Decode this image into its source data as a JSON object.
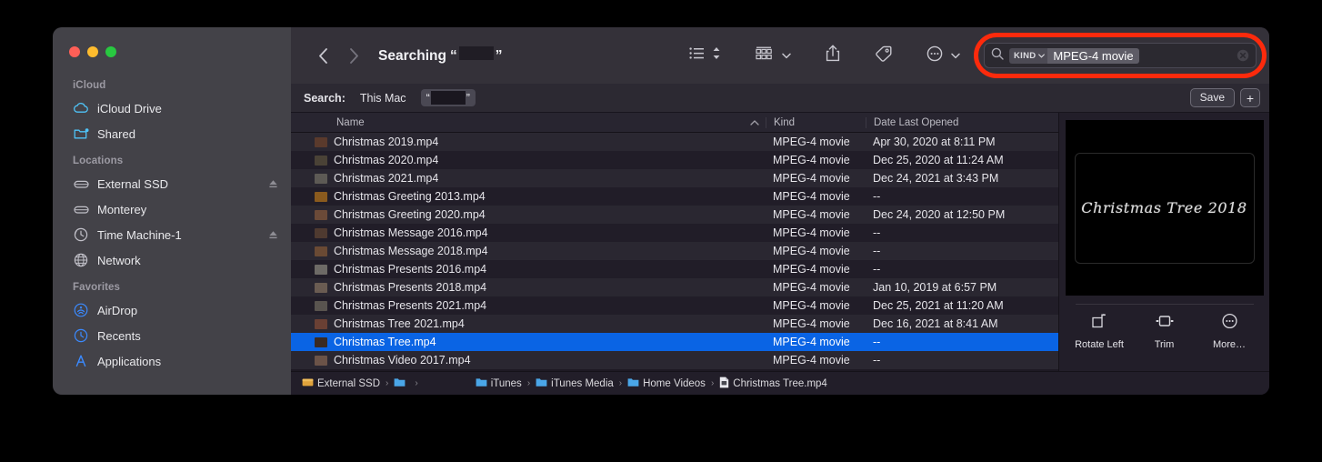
{
  "window": {
    "traffic_lights": [
      "close",
      "minimize",
      "zoom"
    ],
    "title_prefix": "Searching",
    "title_quote_open": "“",
    "title_quote_close": "”"
  },
  "sidebar": {
    "sections": [
      {
        "title": "iCloud",
        "items": [
          {
            "label": "iCloud Drive",
            "icon": "cloud-icon",
            "eject": false
          },
          {
            "label": "Shared",
            "icon": "shared-folder-icon",
            "eject": false
          }
        ]
      },
      {
        "title": "Locations",
        "items": [
          {
            "label": "External SSD",
            "icon": "external-drive-icon",
            "eject": true
          },
          {
            "label": "Monterey",
            "icon": "internal-drive-icon",
            "eject": false
          },
          {
            "label": "Time Machine-1",
            "icon": "time-machine-icon",
            "eject": true
          },
          {
            "label": "Network",
            "icon": "globe-icon",
            "eject": false
          }
        ]
      },
      {
        "title": "Favorites",
        "items": [
          {
            "label": "AirDrop",
            "icon": "airdrop-icon",
            "eject": false
          },
          {
            "label": "Recents",
            "icon": "clock-icon",
            "eject": false
          },
          {
            "label": "Applications",
            "icon": "applications-icon",
            "eject": false
          }
        ]
      }
    ]
  },
  "toolbar": {
    "back_icon": "chevron-left-icon",
    "forward_icon": "chevron-right-icon",
    "view_list_icon": "list-view-icon",
    "view_sort_icon": "sort-chevrons-icon",
    "group_icon": "group-by-icon",
    "group_chevron_icon": "chevron-down-icon",
    "share_icon": "share-icon",
    "tag_icon": "tag-icon",
    "more_icon": "more-circle-icon",
    "more_chevron_icon": "chevron-down-icon"
  },
  "search": {
    "icon": "search-icon",
    "token_kind_label": "KIND",
    "token_kind_chevron": "⌄",
    "token_value": "MPEG-4 movie",
    "clear_icon": "clear-circle-icon",
    "highlight_color": "#fc2a0c"
  },
  "scope_bar": {
    "label": "Search:",
    "tabs": [
      "This Mac"
    ],
    "selected_tab_quote_open": "“",
    "selected_tab_quote_close": "”",
    "save_label": "Save",
    "add_label": "+"
  },
  "columns": {
    "name": "Name",
    "kind": "Kind",
    "date": "Date Last Opened",
    "sort_icon": "chevron-up-icon"
  },
  "files": [
    {
      "name": "Christmas 2019.mp4",
      "kind": "MPEG-4 movie",
      "date": "Apr 30, 2020 at 8:11 PM",
      "thumb": "#5a3a2c",
      "selected": false
    },
    {
      "name": "Christmas 2020.mp4",
      "kind": "MPEG-4 movie",
      "date": "Dec 25, 2020 at 11:24 AM",
      "thumb": "#4a4236",
      "selected": false
    },
    {
      "name": "Christmas 2021.mp4",
      "kind": "MPEG-4 movie",
      "date": "Dec 24, 2021 at 3:43 PM",
      "thumb": "#5d5a55",
      "selected": false
    },
    {
      "name": "Christmas Greeting 2013.mp4",
      "kind": "MPEG-4 movie",
      "date": "--",
      "thumb": "#8a5a1e",
      "selected": false
    },
    {
      "name": "Christmas Greeting 2020.mp4",
      "kind": "MPEG-4 movie",
      "date": "Dec 24, 2020 at 12:50 PM",
      "thumb": "#6b4a38",
      "selected": false
    },
    {
      "name": "Christmas Message 2016.mp4",
      "kind": "MPEG-4 movie",
      "date": "--",
      "thumb": "#4f3a30",
      "selected": false
    },
    {
      "name": "Christmas Message 2018.mp4",
      "kind": "MPEG-4 movie",
      "date": "--",
      "thumb": "#6a4a34",
      "selected": false
    },
    {
      "name": "Christmas Presents 2016.mp4",
      "kind": "MPEG-4 movie",
      "date": "--",
      "thumb": "#6d6a66",
      "selected": false
    },
    {
      "name": "Christmas Presents 2018.mp4",
      "kind": "MPEG-4 movie",
      "date": "Jan 10, 2019 at 6:57 PM",
      "thumb": "#6a5c52",
      "selected": false
    },
    {
      "name": "Christmas Presents 2021.mp4",
      "kind": "MPEG-4 movie",
      "date": "Dec 25, 2021 at 11:20 AM",
      "thumb": "#59544f",
      "selected": false
    },
    {
      "name": "Christmas Tree 2021.mp4",
      "kind": "MPEG-4 movie",
      "date": "Dec 16, 2021 at 8:41 AM",
      "thumb": "#6a4034",
      "selected": false
    },
    {
      "name": "Christmas Tree.mp4",
      "kind": "MPEG-4 movie",
      "date": "--",
      "thumb": "#3a2a22",
      "selected": true
    },
    {
      "name": "Christmas Video 2017.mp4",
      "kind": "MPEG-4 movie",
      "date": "--",
      "thumb": "#6b5348",
      "selected": false
    }
  ],
  "preview": {
    "frame_text": "Christmas Tree 2018",
    "actions": [
      {
        "label": "Rotate Left",
        "icon": "rotate-left-icon"
      },
      {
        "label": "Trim",
        "icon": "trim-icon"
      },
      {
        "label": "More…",
        "icon": "more-circle-icon"
      }
    ]
  },
  "path_bar": {
    "crumbs": [
      {
        "label": "External SSD",
        "icon": "drive-icon"
      },
      {
        "label": "",
        "icon": "folder-icon"
      },
      {
        "label": "iTunes",
        "icon": "folder-icon"
      },
      {
        "label": "iTunes Media",
        "icon": "folder-icon"
      },
      {
        "label": "Home Videos",
        "icon": "folder-icon"
      },
      {
        "label": "Christmas Tree.mp4",
        "icon": "file-icon"
      }
    ],
    "separator": "›"
  }
}
